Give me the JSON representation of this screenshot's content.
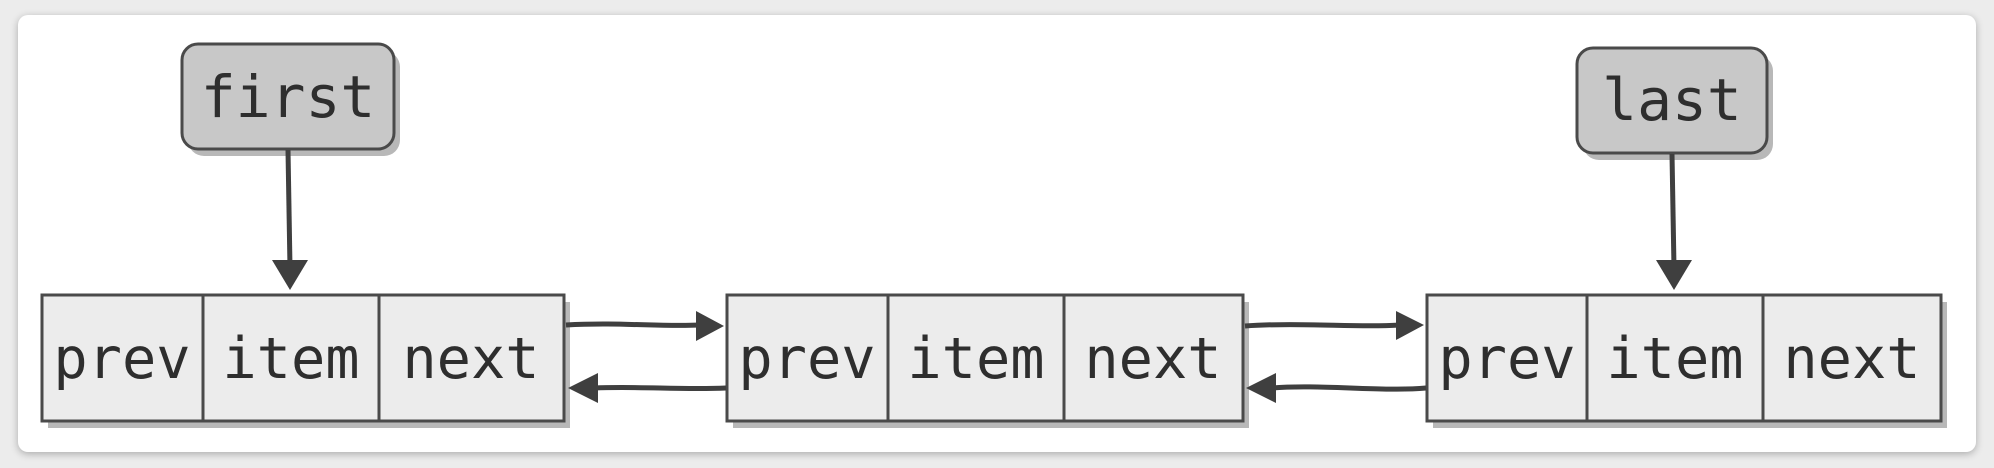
{
  "pointers": {
    "first": {
      "label": "first"
    },
    "last": {
      "label": "last"
    }
  },
  "nodes": [
    {
      "fields": [
        "prev",
        "item",
        "next"
      ]
    },
    {
      "fields": [
        "prev",
        "item",
        "next"
      ]
    },
    {
      "fields": [
        "prev",
        "item",
        "next"
      ]
    }
  ],
  "colors": {
    "pointer_fill": "#c8c8c8",
    "node_fill": "#ececec",
    "stroke": "#4a4a4a",
    "arrow": "#3f3f3f",
    "shadow": "#b8b8b8"
  }
}
